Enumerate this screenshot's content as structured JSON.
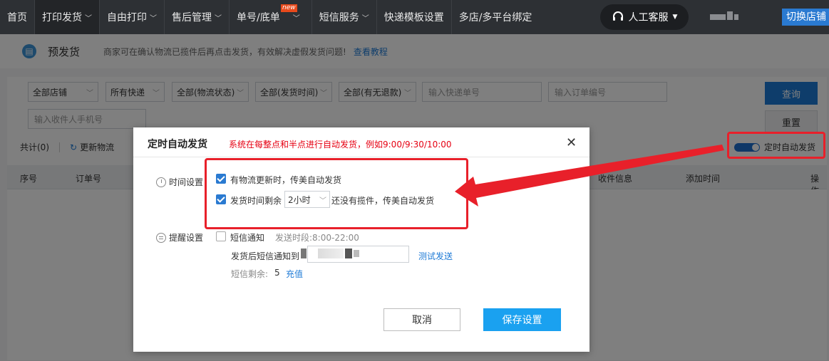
{
  "topnav": {
    "items": [
      {
        "label": "首页",
        "chevron": false
      },
      {
        "label": "打印发货",
        "chevron": true
      },
      {
        "label": "自由打印",
        "chevron": true
      },
      {
        "label": "售后管理",
        "chevron": true
      },
      {
        "label": "单号/底单",
        "chevron": true
      },
      {
        "label": "短信服务",
        "chevron": true
      },
      {
        "label": "快递模板设置",
        "chevron": false
      },
      {
        "label": "多店/多平台绑定",
        "chevron": false
      }
    ],
    "new_badge": "new",
    "service_label": "人工客服",
    "switch_shop": "切换店铺"
  },
  "page": {
    "title": "预发货",
    "description": "商家可在确认物流已揽件后再点击发货，有效解决虚假发货问题!",
    "tutorial_link": "查看教程",
    "filters": {
      "shop": "全部店铺",
      "express": "所有快递",
      "logistics_status": "全部(物流状态)",
      "ship_time": "全部(发货时间)",
      "refund": "全部(有无退款)",
      "tracking_placeholder": "输入快递单号",
      "order_placeholder": "输入订单编号",
      "phone_placeholder": "输入收件人手机号"
    },
    "query_button": "查询",
    "reset_button": "重置",
    "total": "共计(0)",
    "refresh_logistics": "更新物流",
    "auto_ship_toggle_label": "定时自动发货",
    "auto_ship_toggle_on": true,
    "table_headers": {
      "seq": "序号",
      "order_no": "订单号",
      "receiver": "收件信息",
      "added_time": "添加时间",
      "actions": "操作"
    }
  },
  "modal": {
    "title": "定时自动发货",
    "tip": "系统在每整点和半点进行自动发货，例如9:00/9:30/10:00",
    "time_settings_label": "时间设置",
    "option1": {
      "checked": true,
      "label": "有物流更新时，传美自动发货"
    },
    "option2": {
      "checked": true,
      "label_before": "发货时间剩余",
      "hours_value": "2小时",
      "label_after": "还没有揽件，传美自动发货"
    },
    "reminder_label": "提醒设置",
    "sms_notice": {
      "checked": false,
      "label": "短信通知",
      "send_period": "发送时段:8:00-22:00"
    },
    "sms_to_label": "发货后短信通知到",
    "test_send": "测试发送",
    "sms_remaining_label": "短信剩余:",
    "sms_remaining_count": "5",
    "recharge": "充值",
    "cancel_button": "取消",
    "save_button": "保存设置"
  },
  "colors": {
    "accent": "#1aa1f0",
    "link": "#1d7ad6",
    "annotation": "#e8202a",
    "tip": "#e60012"
  }
}
